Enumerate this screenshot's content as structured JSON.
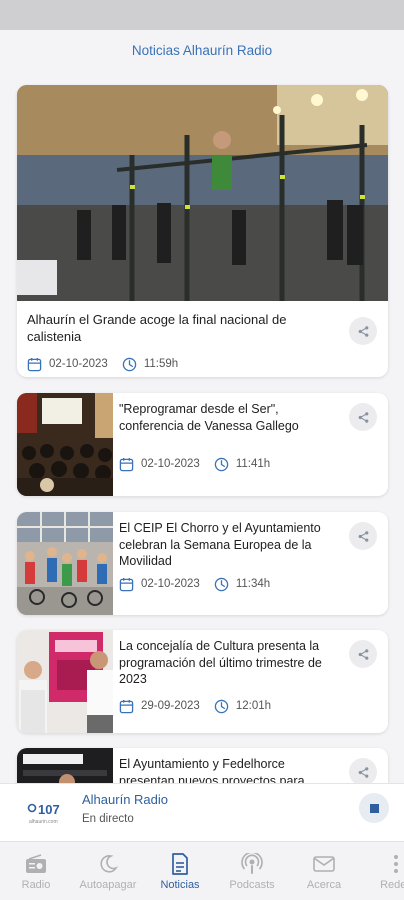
{
  "app": {
    "title": "Noticias Alhaurín Radio"
  },
  "articles": [
    {
      "title": "Alhaurín el Grande acoge la final nacional de calistenia",
      "date": "02-10-2023",
      "time": "11:59h"
    },
    {
      "title": "\"Reprogramar desde el Ser\", conferencia de Vanessa Gallego",
      "date": "02-10-2023",
      "time": "11:41h"
    },
    {
      "title": "El CEIP El Chorro y el Ayuntamiento celebran la Semana Europea de la Movilidad",
      "date": "02-10-2023",
      "time": "11:34h"
    },
    {
      "title": "La concejalía de Cultura presenta la programación del último trimestre de 2023",
      "date": "29-09-2023",
      "time": "12:01h"
    },
    {
      "title": "El Ayuntamiento y Fedelhorce presentan nuevos proyectos para",
      "date": "",
      "time": ""
    }
  ],
  "player": {
    "station": "Alhaurín Radio",
    "status": "En directo",
    "logo_text": "107",
    "logo_sub": "alhaurin.com"
  },
  "nav": {
    "items": [
      {
        "label": "Radio",
        "icon": "radio-icon"
      },
      {
        "label": "Autoapagar",
        "icon": "moon-icon"
      },
      {
        "label": "Noticias",
        "icon": "document-icon"
      },
      {
        "label": "Podcasts",
        "icon": "podcast-icon"
      },
      {
        "label": "Acerca",
        "icon": "mail-icon"
      },
      {
        "label": "Redes",
        "icon": "more-vertical-icon"
      }
    ],
    "active": "Noticias"
  },
  "colors": {
    "accent": "#2f5f9e",
    "title": "#3a72b8",
    "inactive": "#b0b0b3"
  }
}
